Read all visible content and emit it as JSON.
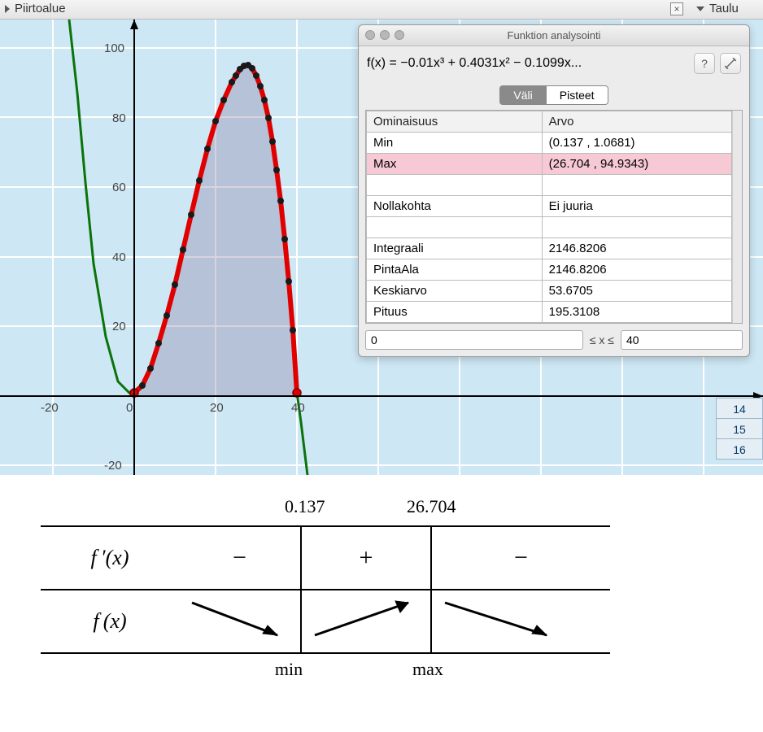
{
  "panels": {
    "plot_label": "Piirtoalue",
    "sheet_label": "Taulu"
  },
  "chart_data": {
    "type": "line",
    "title": "",
    "xlabel": "",
    "ylabel": "",
    "xlim": [
      -30,
      60
    ],
    "ylim": [
      -25,
      105
    ],
    "x_ticks": [
      -20,
      0,
      20,
      40
    ],
    "y_ticks": [
      -20,
      20,
      40,
      60,
      80,
      100
    ],
    "function": "-0.01x^3 + 0.4031x^2 - 0.1099x",
    "integration_bounds": [
      0,
      40
    ],
    "data_points_x": [
      0,
      2,
      4,
      6,
      8,
      10,
      12,
      14,
      16,
      18,
      20,
      22,
      24,
      25,
      26,
      27,
      28,
      29,
      30,
      31,
      32,
      33,
      34,
      35,
      36,
      37,
      38,
      39,
      40
    ],
    "data_points_y": [
      1,
      3,
      8,
      15,
      23,
      32,
      42,
      52,
      62,
      71,
      79,
      85,
      90,
      92,
      94,
      95,
      95,
      94,
      92,
      89,
      85,
      80,
      73,
      65,
      56,
      45,
      33,
      19,
      1
    ],
    "min_point": [
      0.137,
      1.0681
    ],
    "max_point": [
      26.704,
      94.9343
    ]
  },
  "analysis": {
    "window_title": "Funktion analysointi",
    "formula": "f(x) = −0.01x³ + 0.4031x² − 0.1099x...",
    "tabs": {
      "interval": "Väli",
      "points": "Pisteet"
    },
    "columns": {
      "prop": "Ominaisuus",
      "val": "Arvo"
    },
    "rows": [
      {
        "prop": "Min",
        "val": "(0.137 , 1.0681)",
        "hl": false
      },
      {
        "prop": "Max",
        "val": "(26.704 , 94.9343)",
        "hl": true
      },
      {
        "prop": "",
        "val": ""
      },
      {
        "prop": "Nollakohta",
        "val": "Ei juuria"
      },
      {
        "prop": "",
        "val": ""
      },
      {
        "prop": "Integraali",
        "val": "2146.8206"
      },
      {
        "prop": "PintaAla",
        "val": "2146.8206"
      },
      {
        "prop": "Keskiarvo",
        "val": "53.6705"
      },
      {
        "prop": "Pituus",
        "val": "195.3108"
      }
    ],
    "range": {
      "from": "0",
      "label": "≤ x ≤",
      "to": "40"
    }
  },
  "sheet": {
    "rows": [
      "14",
      "15",
      "16"
    ]
  },
  "sign_table": {
    "crit1": "0.137",
    "crit2": "26.704",
    "row1_label": "f ′(x)",
    "row2_label": "f (x)",
    "signs": [
      "−",
      "+",
      "−"
    ],
    "min_label": "min",
    "max_label": "max"
  }
}
